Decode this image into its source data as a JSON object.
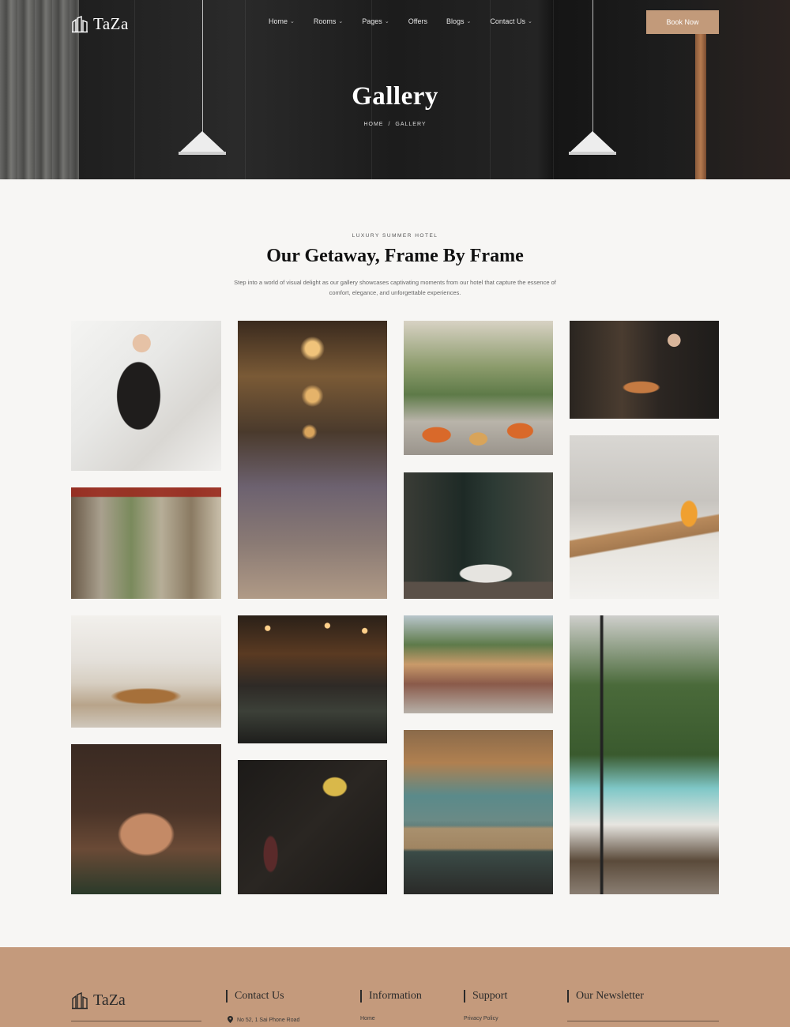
{
  "brand": {
    "name": "TaZa"
  },
  "nav": {
    "items": [
      {
        "label": "Home"
      },
      {
        "label": "Rooms"
      },
      {
        "label": "Pages"
      },
      {
        "label": "Offers"
      },
      {
        "label": "Blogs"
      },
      {
        "label": "Contact Us"
      }
    ],
    "cta_label": "Book Now"
  },
  "hero": {
    "title": "Gallery",
    "breadcrumb": {
      "home": "HOME",
      "separator": "/",
      "current": "GALLERY"
    }
  },
  "section": {
    "eyebrow": "LUXURY SUMMER HOTEL",
    "title": "Our Getaway, Frame By Frame",
    "description": "Step into a world of visual delight as our gallery showcases captivating moments from our hotel that capture the essence of comfort, elegance, and unforgettable experiences."
  },
  "gallery": {
    "images": [
      {
        "subject": "housekeeper-making-bed"
      },
      {
        "subject": "hotel-lobby-chandeliers"
      },
      {
        "subject": "atrium-lounge-orange-sofas"
      },
      {
        "subject": "waitress-serving-food"
      },
      {
        "subject": "veranda-archways"
      },
      {
        "subject": "bathroom-bathtub"
      },
      {
        "subject": "breakfast-in-bed"
      },
      {
        "subject": "buffet-chefs"
      },
      {
        "subject": "restaurant-interior"
      },
      {
        "subject": "resort-pool-palms"
      },
      {
        "subject": "poolside-lounge-terrace"
      },
      {
        "subject": "spa-massage"
      },
      {
        "subject": "wine-pouring"
      },
      {
        "subject": "lobby-reception"
      }
    ]
  },
  "footer": {
    "brand": "TaZa",
    "columns": [
      {
        "title": "Contact Us",
        "first_item": "No 52, 1 Sai Phone Road"
      },
      {
        "title": "Information",
        "first_item": "Home"
      },
      {
        "title": "Support",
        "first_item": "Privacy Policy"
      },
      {
        "title": "Our Newsletter",
        "first_item": ""
      }
    ]
  },
  "colors": {
    "accent": "#c29a7a",
    "footer_bg": "#c49a7c",
    "page_bg": "#f7f6f4",
    "hero_bg": "#1e1e1e"
  }
}
